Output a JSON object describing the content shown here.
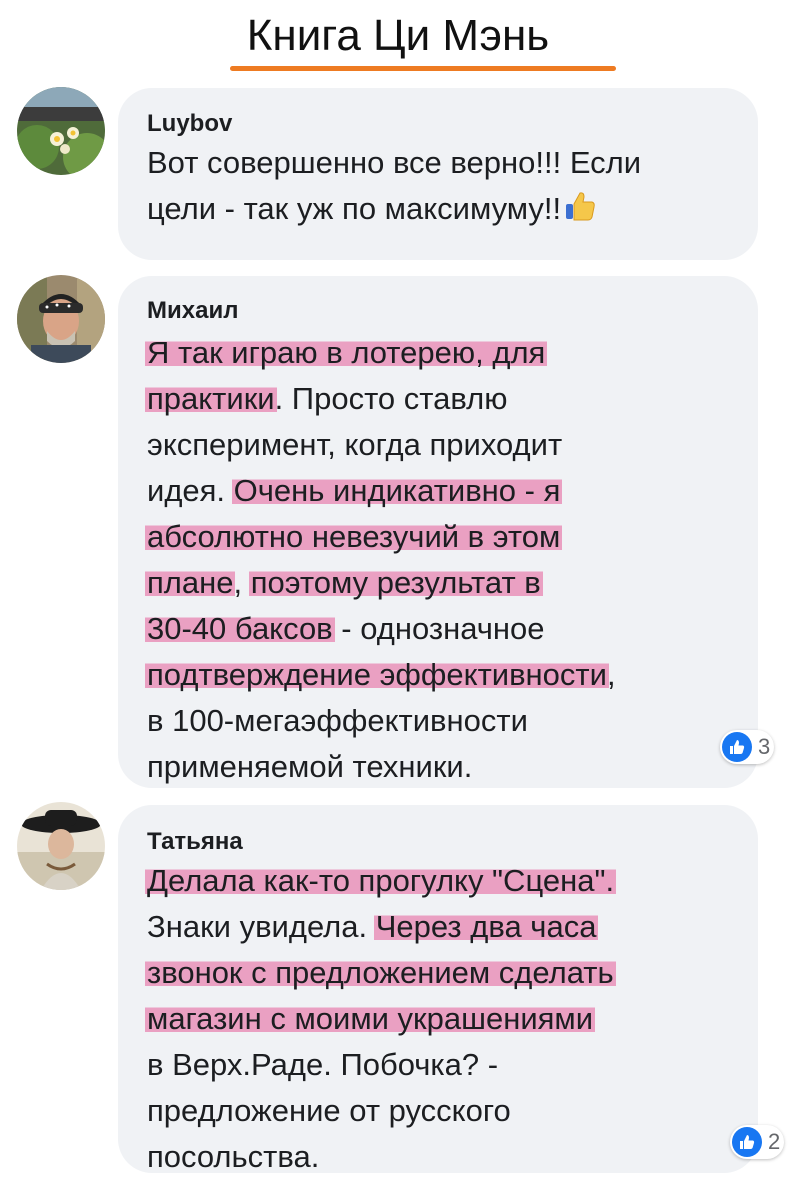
{
  "page_title": "Книга Ци Мэнь",
  "colors": {
    "title_underline": "#ee7b22",
    "bubble": "#f0f2f5",
    "highlight": "#e76ea3",
    "like_blue": "#1877f2"
  },
  "comments": [
    {
      "author": "Luybov",
      "avatar_icon": "flower-photo",
      "lines": [
        [
          {
            "t": "Вот совершенно все верно!!! Если",
            "h": false
          }
        ],
        [
          {
            "t": "цели - так уж по максимуму!!",
            "h": false
          }
        ]
      ],
      "trailing_emoji": "thumbs-up-emoji"
    },
    {
      "author": "Михаил",
      "avatar_icon": "man-bandana-photo",
      "lines": [
        [
          {
            "t": "Я так играю в лотерею, для",
            "h": true
          }
        ],
        [
          {
            "t": "практики",
            "h": true
          },
          {
            "t": ". Просто ставлю",
            "h": false
          }
        ],
        [
          {
            "t": "эксперимент, когда приходит",
            "h": false
          }
        ],
        [
          {
            "t": "идея. ",
            "h": false
          },
          {
            "t": "Очень индикативно - я",
            "h": true
          }
        ],
        [
          {
            "t": "абсолютно невезучий в этом",
            "h": true
          }
        ],
        [
          {
            "t": "плане",
            "h": true
          },
          {
            "t": ", ",
            "h": false
          },
          {
            "t": "поэтому результат в",
            "h": true
          }
        ],
        [
          {
            "t": "30-40 баксов",
            "h": true
          },
          {
            "t": " - однозначное",
            "h": false
          }
        ],
        [
          {
            "t": "подтверждение эффективности",
            "h": true
          },
          {
            "t": ",",
            "h": false
          }
        ],
        [
          {
            "t": "в 100-мегаэффективности",
            "h": false
          }
        ],
        [
          {
            "t": "применяемой техники.",
            "h": false
          }
        ]
      ],
      "reaction": {
        "icon": "like-icon",
        "count": "3"
      }
    },
    {
      "author": "Татьяна",
      "avatar_icon": "woman-hat-photo",
      "lines": [
        [
          {
            "t": "Делала как-то прогулку \"Сцена\".",
            "h": true
          }
        ],
        [
          {
            "t": "Знаки увидела. ",
            "h": false
          },
          {
            "t": "Через два часа",
            "h": true
          }
        ],
        [
          {
            "t": "звонок с предложением сделать",
            "h": true
          }
        ],
        [
          {
            "t": "магазин с моими украшениями",
            "h": true
          }
        ],
        [
          {
            "t": "в Верх.Раде. Побочка? -",
            "h": false
          }
        ],
        [
          {
            "t": "предложение от русского",
            "h": false
          }
        ],
        [
          {
            "t": "посольства.",
            "h": false
          }
        ]
      ],
      "reaction": {
        "icon": "like-icon",
        "count": "2"
      }
    }
  ]
}
